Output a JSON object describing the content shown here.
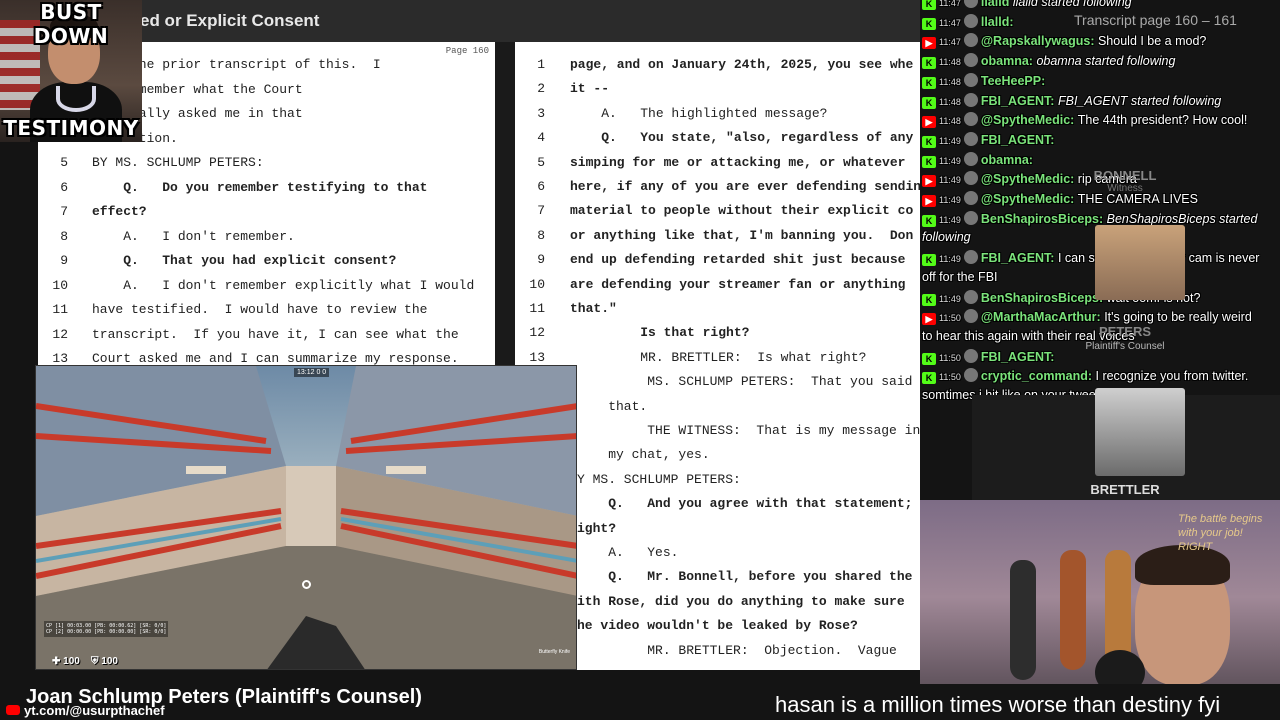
{
  "titlebar": {
    "title": "ed or Explicit Consent"
  },
  "thumbnail": {
    "caption_top": "BUST DOWN",
    "caption_bottom": "TESTIMONY"
  },
  "page_left": {
    "page_label": "Page 160",
    "lines": [
      {
        "num": "",
        "text": "view the prior transcript of this.  I",
        "bold": false
      },
      {
        "num": "",
        "text": "n't remember what the Court",
        "bold": false
      },
      {
        "num": "",
        "text": "ecifically asked me in that",
        "bold": false
      },
      {
        "num": "",
        "text": "nversation.",
        "bold": false
      },
      {
        "num": "5",
        "text": "BY MS. SCHLUMP PETERS:",
        "bold": false
      },
      {
        "num": "6",
        "text": "    Q.   Do you remember testifying to that",
        "bold": true
      },
      {
        "num": "7",
        "text": "effect?",
        "bold": true
      },
      {
        "num": "8",
        "text": "    A.   I don't remember.",
        "bold": false
      },
      {
        "num": "9",
        "text": "    Q.   That you had explicit consent?",
        "bold": true
      },
      {
        "num": "10",
        "text": "    A.   I don't remember explicitly what I would",
        "bold": false
      },
      {
        "num": "11",
        "text": "have testified.  I would have to review the",
        "bold": false
      },
      {
        "num": "12",
        "text": "transcript.  If you have it, I can see what the",
        "bold": false
      },
      {
        "num": "13",
        "text": "Court asked me and I can summarize my response.",
        "bold": false
      }
    ]
  },
  "page_right": {
    "lines": [
      {
        "num": "1",
        "text": "page, and on January 24th, 2025, you see whe",
        "bold": true
      },
      {
        "num": "2",
        "text": "it --",
        "bold": true
      },
      {
        "num": "3",
        "text": "    A.   The highlighted message?",
        "bold": false
      },
      {
        "num": "4",
        "text": "    Q.   You state, \"also, regardless of any",
        "bold": true
      },
      {
        "num": "5",
        "text": "simping for me or attacking me, or whatever",
        "bold": true
      },
      {
        "num": "6",
        "text": "here, if any of you are ever defending sendin",
        "bold": true
      },
      {
        "num": "7",
        "text": "material to people without their explicit co",
        "bold": true
      },
      {
        "num": "8",
        "text": "or anything like that, I'm banning you.  Don",
        "bold": true
      },
      {
        "num": "9",
        "text": "end up defending retarded shit just because",
        "bold": true
      },
      {
        "num": "10",
        "text": "are defending your streamer fan or anything",
        "bold": true
      },
      {
        "num": "11",
        "text": "that.\"",
        "bold": true
      },
      {
        "num": "12",
        "text": "         Is that right?",
        "bold": true
      },
      {
        "num": "13",
        "text": "         MR. BRETTLER:  Is what right?",
        "bold": false
      },
      {
        "num": "",
        "text": "         MS. SCHLUMP PETERS:  That you said",
        "bold": false
      },
      {
        "num": "",
        "text": "    that.",
        "bold": false
      },
      {
        "num": "",
        "text": "         THE WITNESS:  That is my message in",
        "bold": false
      },
      {
        "num": "",
        "text": "    my chat, yes.",
        "bold": false
      },
      {
        "num": "",
        "text": "Y MS. SCHLUMP PETERS:",
        "bold": false
      },
      {
        "num": "",
        "text": "    Q.   And you agree with that statement;",
        "bold": true
      },
      {
        "num": "",
        "text": "ight?",
        "bold": true
      },
      {
        "num": "",
        "text": "    A.   Yes.",
        "bold": false
      },
      {
        "num": "",
        "text": "    Q.   Mr. Bonnell, before you shared the",
        "bold": true
      },
      {
        "num": "",
        "text": "ith Rose, did you do anything to make sure",
        "bold": true
      },
      {
        "num": "",
        "text": "he video wouldn't be leaked by Rose?",
        "bold": true
      },
      {
        "num": "",
        "text": "         MR. BRETTLER:  Objection.  Vague",
        "bold": false
      }
    ]
  },
  "game": {
    "hud_top": "13:12\n0 0",
    "health": "100",
    "armor": "100",
    "weapon": "Butterfly Knife",
    "stats": "CP [1] 00:03.00 [PB: 00:00.62] [SR: 0/0]\nCP [2] 00:00.00 [PB: 00:00.00] [SR: 0/0]"
  },
  "chat": {
    "header": "Transcript page 160 – 161",
    "messages": [
      {
        "platform": "kick",
        "time": "11:47",
        "user": "llalld",
        "body": "llalld started following",
        "italic": true
      },
      {
        "platform": "kick",
        "time": "11:47",
        "user": "llalld:",
        "body": "",
        "italic": false
      },
      {
        "platform": "yt",
        "time": "11:47",
        "user": "@Rapskallywagus:",
        "body": "Should I be a mod?",
        "italic": false
      },
      {
        "platform": "kick",
        "time": "11:48",
        "user": "obamna:",
        "body": "obamna started following",
        "italic": true
      },
      {
        "platform": "kick",
        "time": "11:48",
        "user": "TeeHeePP:",
        "body": "",
        "italic": false
      },
      {
        "platform": "kick",
        "time": "11:48",
        "user": "FBI_AGENT:",
        "body": "FBI_AGENT started following",
        "italic": true
      },
      {
        "platform": "yt",
        "time": "11:48",
        "user": "@SpytheMedic:",
        "body": "The 44th president? How cool!",
        "italic": false
      },
      {
        "platform": "kick",
        "time": "11:49",
        "user": "FBI_AGENT:",
        "body": "",
        "italic": false
      },
      {
        "platform": "kick",
        "time": "11:49",
        "user": "obamna:",
        "body": "",
        "italic": false
      },
      {
        "platform": "yt",
        "time": "11:49",
        "user": "@SpytheMedic:",
        "body": "rip camera",
        "italic": false
      },
      {
        "platform": "yt",
        "time": "11:49",
        "user": "@SpytheMedic:",
        "body": "THE CAMERA LIVES",
        "italic": false
      },
      {
        "platform": "kick",
        "time": "11:49",
        "user": "BenShapirosBiceps:",
        "body": "BenShapirosBiceps started",
        "italic": true
      },
      {
        "platform": "",
        "time": "",
        "user": "",
        "body": "following",
        "italic": true
      },
      {
        "platform": "kick",
        "time": "11:49",
        "user": "FBI_AGENT:",
        "body": "I can still see you, your cam is never",
        "italic": false
      },
      {
        "platform": "",
        "time": "",
        "user": "",
        "body": "off for the FBI",
        "italic": false
      },
      {
        "platform": "kick",
        "time": "11:49",
        "user": "BenShapirosBiceps:",
        "body": "wait oomf is hot?",
        "italic": false
      },
      {
        "platform": "yt",
        "time": "11:50",
        "user": "@MarthaMacArthur:",
        "body": "It's going to be really weird",
        "italic": false
      },
      {
        "platform": "",
        "time": "",
        "user": "",
        "body": "to hear this again with their real voices",
        "italic": false
      },
      {
        "platform": "kick",
        "time": "11:50",
        "user": "FBI_AGENT:",
        "body": "",
        "italic": false
      },
      {
        "platform": "kick",
        "time": "11:50",
        "user": "cryptic_command:",
        "body": "I recognize you from twitter.",
        "italic": false
      },
      {
        "platform": "",
        "time": "",
        "user": "",
        "body": "somtimes i hit like on your tweets",
        "italic": false
      }
    ]
  },
  "tiles": {
    "bonnell_label": "BONNELL",
    "bonnell_sub": "Witness",
    "peters_label": "PETERS",
    "peters_sub": "Plaintiff's Counsel",
    "brettler_label": "BRETTLER"
  },
  "cam": {
    "caption": "The battle begins\nwith your job!\nRIGHT"
  },
  "lower": {
    "name": "Joan Schlump Peters (Plaintiff's Counsel)",
    "handle": "yt.com/@usurpthachef",
    "ticker": "hasan is a million times worse than destiny fyi"
  },
  "colors": {
    "kick": "#53fc18",
    "youtube": "#ff0000",
    "username": "#7be37b"
  }
}
